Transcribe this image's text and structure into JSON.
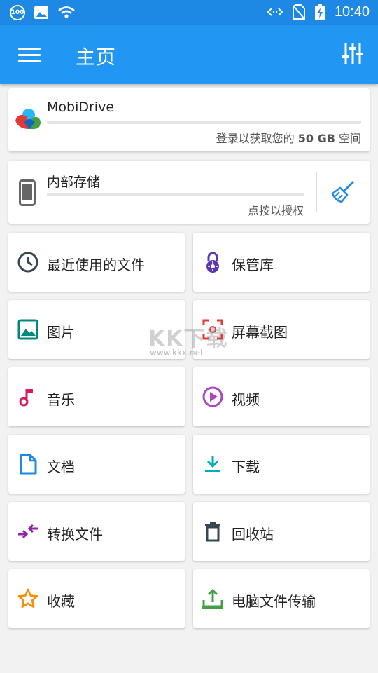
{
  "status_bar": {
    "battery_badge": "100",
    "time": "10:40"
  },
  "app_bar": {
    "title": "主页"
  },
  "cloud": {
    "name": "MobiDrive",
    "subtitle_prefix": "登录以获取您的 ",
    "subtitle_bold": "50 GB",
    "subtitle_suffix": " 空间"
  },
  "storage": {
    "name": "内部存储",
    "subtitle": "点按以授权"
  },
  "tiles": [
    {
      "label": "最近使用的文件",
      "icon": "clock-icon"
    },
    {
      "label": "保管库",
      "icon": "lock-icon"
    },
    {
      "label": "图片",
      "icon": "image-icon"
    },
    {
      "label": "屏幕截图",
      "icon": "screenshot-icon"
    },
    {
      "label": "音乐",
      "icon": "music-note-icon"
    },
    {
      "label": "视频",
      "icon": "play-circle-icon"
    },
    {
      "label": "文档",
      "icon": "document-icon"
    },
    {
      "label": "下载",
      "icon": "download-icon"
    },
    {
      "label": "转换文件",
      "icon": "convert-icon"
    },
    {
      "label": "回收站",
      "icon": "trash-icon"
    },
    {
      "label": "收藏",
      "icon": "star-icon"
    },
    {
      "label": "电脑文件传输",
      "icon": "pc-transfer-icon"
    }
  ],
  "watermark": {
    "big": "KK下载",
    "small": "www.kkx.net"
  },
  "colors": {
    "app_bar": "#2196f3",
    "status_bar": "#1e88e5",
    "background": "#f2f2f2"
  }
}
